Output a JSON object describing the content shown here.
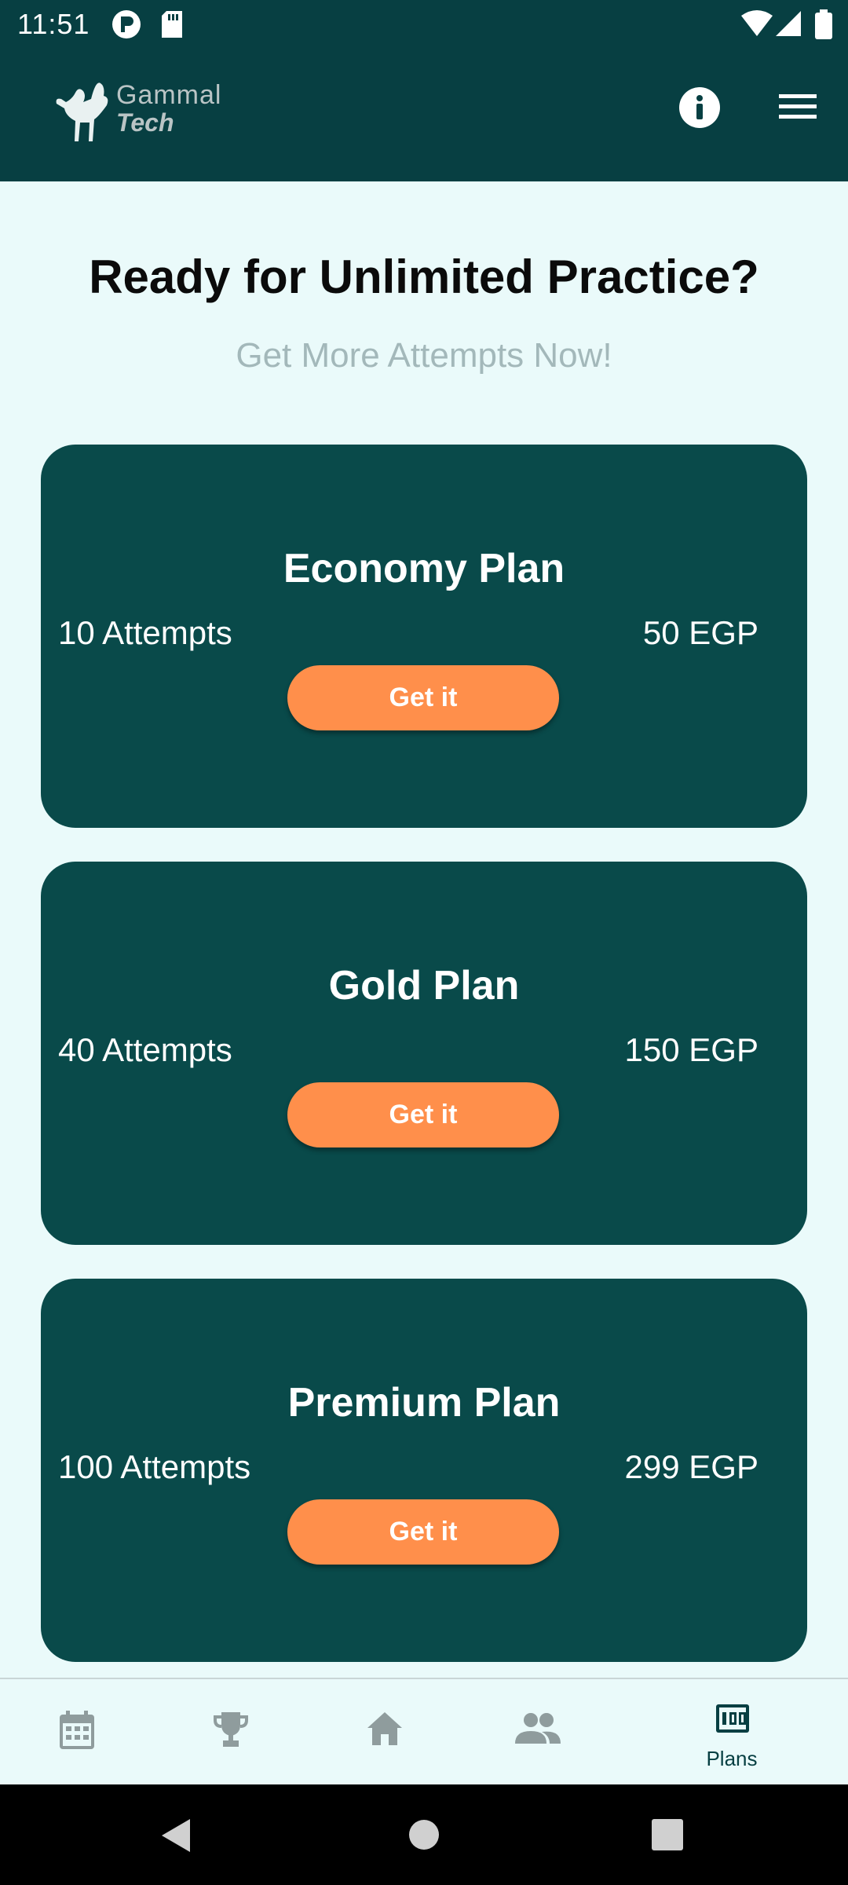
{
  "status_bar": {
    "time": "11:51"
  },
  "header": {
    "logo_line1": "Gammal",
    "logo_line2": "Tech"
  },
  "main": {
    "headline": "Ready for Unlimited Practice?",
    "subline": "Get More Attempts Now!"
  },
  "plans": [
    {
      "title": "Economy Plan",
      "attempts": "10 Attempts",
      "price": "50 EGP",
      "button": "Get it"
    },
    {
      "title": "Gold Plan",
      "attempts": "40 Attempts",
      "price": "150 EGP",
      "button": "Get it"
    },
    {
      "title": "Premium Plan",
      "attempts": "100 Attempts",
      "price": "299 EGP",
      "button": "Get it"
    }
  ],
  "bottom_nav": {
    "items": [
      {
        "icon": "calendar-icon"
      },
      {
        "icon": "trophy-icon"
      },
      {
        "icon": "home-icon"
      },
      {
        "icon": "group-icon"
      },
      {
        "icon": "plans-icon",
        "label": "Plans"
      }
    ]
  },
  "colors": {
    "header_bg": "#073f42",
    "card_bg": "#094a4a",
    "accent": "#ff8f4b",
    "page_bg": "#eafafa"
  }
}
